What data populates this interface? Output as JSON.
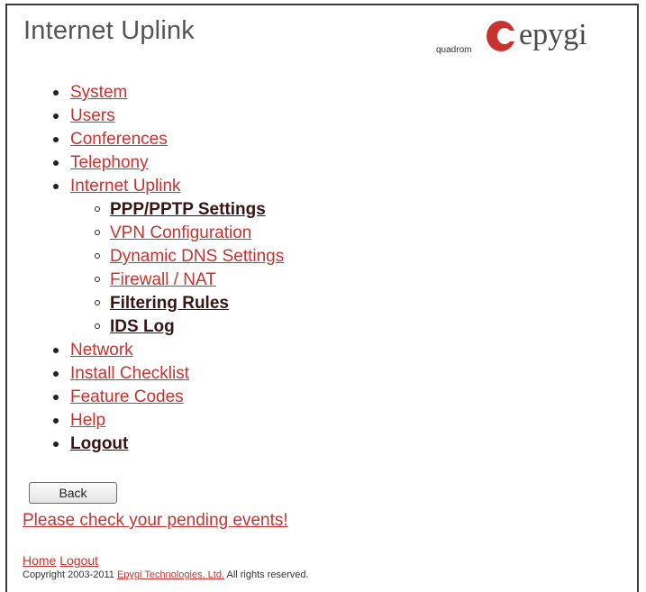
{
  "page": {
    "title": "Internet Uplink"
  },
  "logo": {
    "sub": "quadrom",
    "brand": "epygi",
    "brand_color": "#c8332f"
  },
  "menu": {
    "items": [
      {
        "label": "System"
      },
      {
        "label": "Users"
      },
      {
        "label": "Conferences"
      },
      {
        "label": "Telephony"
      },
      {
        "label": "Internet Uplink",
        "current": true
      },
      {
        "label": "Network"
      },
      {
        "label": "Install Checklist"
      },
      {
        "label": "Feature Codes"
      },
      {
        "label": "Help"
      },
      {
        "label": "Logout"
      }
    ],
    "subitems": [
      {
        "label": "PPP/PPTP Settings"
      },
      {
        "label": "VPN Configuration"
      },
      {
        "label": "Dynamic DNS Settings"
      },
      {
        "label": "Firewall / NAT"
      },
      {
        "label": "Filtering Rules"
      },
      {
        "label": "IDS Log"
      }
    ]
  },
  "actions": {
    "back_label": "Back",
    "pending_events": "Please check your pending events!"
  },
  "footer": {
    "home": "Home",
    "logout": "Logout",
    "copyright_prefix": "Copyright 2003-2011",
    "company": "Epygi Technologies, Ltd.",
    "copyright_suffix": "All rights reserved."
  },
  "colors": {
    "link": "#c8332f",
    "link_visited": "#5a1f1f",
    "frame": "#3a3a3a"
  }
}
